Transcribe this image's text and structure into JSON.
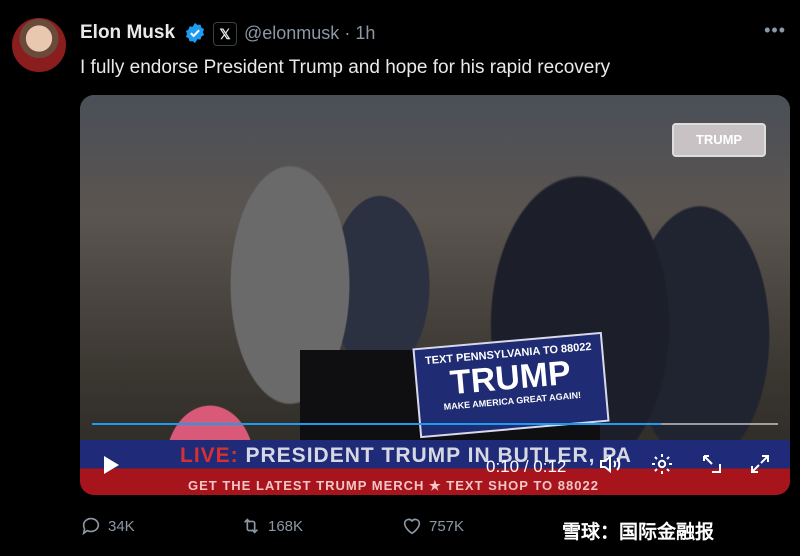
{
  "tweet": {
    "author_name": "Elon Musk",
    "x_badge": "𝕏",
    "handle": "@elonmusk",
    "separator": "·",
    "time": "1h",
    "more": "•••",
    "text": "I fully endorse President Trump and hope for his rapid recovery"
  },
  "video": {
    "crowd_sign": "TRUMP",
    "sign_top": "TEXT PENNSYLVANIA TO 88022",
    "sign_main": "TRUMP",
    "sign_bottom": "MAKE AMERICA GREAT AGAIN!",
    "banner_live": "LIVE:",
    "banner_main": " PRESIDENT TRUMP IN BUTLER, PA",
    "banner_sub": "GET THE LATEST TRUMP MERCH  ★  TEXT SHOP TO 88022",
    "current_time": "0:10",
    "duration": "0:12",
    "time_separator": " / ",
    "progress_fraction": 0.83
  },
  "actions": {
    "replies": "34K",
    "reposts": "168K",
    "likes": "757K"
  },
  "watermark": "雪球：国际金融报",
  "colors": {
    "accent": "#1d9bf0",
    "muted": "#8b98a5",
    "background": "#000000"
  }
}
